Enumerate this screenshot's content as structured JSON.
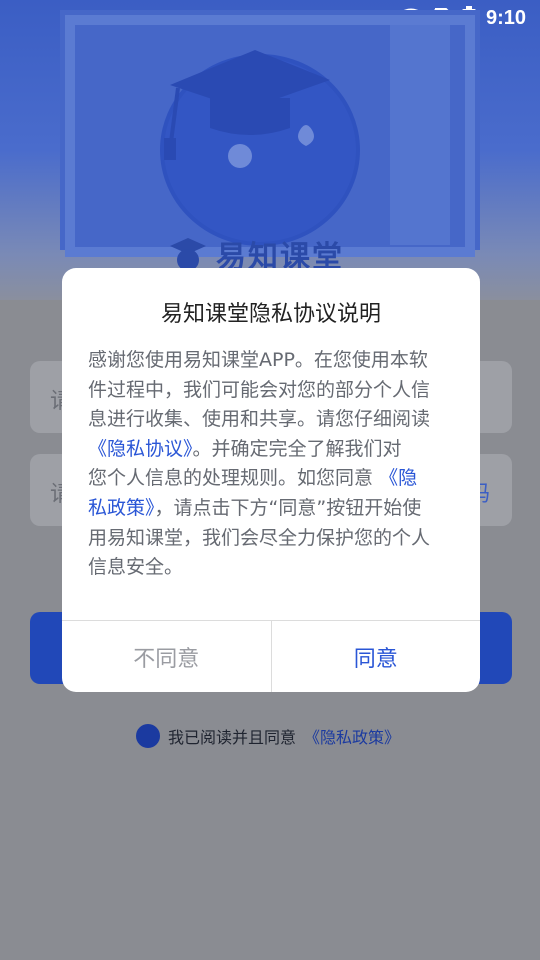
{
  "status_bar": {
    "time": "9:10"
  },
  "app": {
    "logo_text": "易知课堂"
  },
  "login": {
    "account_placeholder": "请",
    "code_placeholder": "请",
    "code_side_text": "码"
  },
  "agreement": {
    "text": "我已阅读并且同意",
    "link": "《隐私政策》"
  },
  "dialog": {
    "title": "易知课堂隐私协议说明",
    "lines": [
      "感谢您使用易知课堂APP。在您使用本软",
      "件过程中，我们可能会对您的部分个人信",
      "息进行收集、使用和共享。请您仔细阅读"
    ],
    "link_privacy_agreement": "《隐私协议》",
    "after_link1": "。并确定完全了解我们对",
    "line5": "您个人信息的处理规则。如您同意",
    "link_privacy_policy_a": "《隐",
    "link_privacy_policy_b": "私政策》",
    "after_link2": "，请点击下方“同意”按钮开始使",
    "line7": "用易知课堂，我们会尽全力保护您的个人",
    "line8": "信息安全。",
    "disagree_label": "不同意",
    "agree_label": "同意"
  }
}
